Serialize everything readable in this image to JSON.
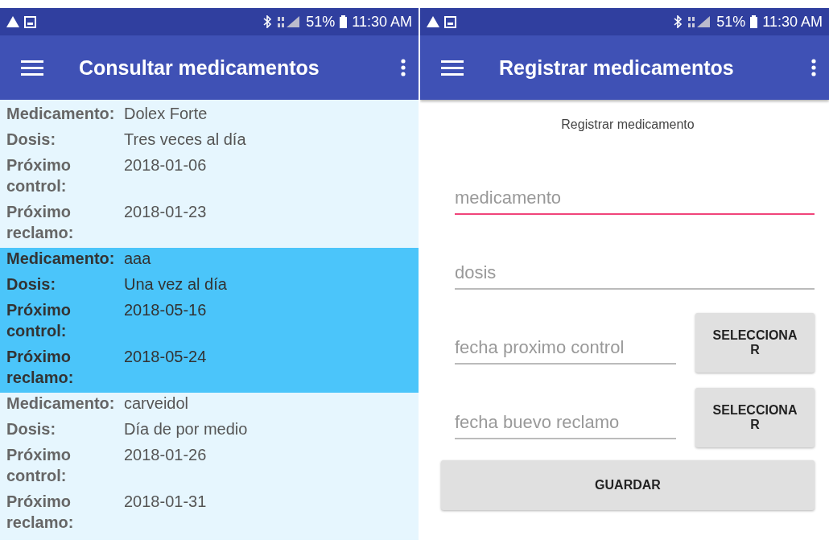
{
  "screens": [
    {
      "status_bar": {
        "battery": "51%",
        "time": "11:30 AM"
      },
      "app_bar": {
        "title": "Consultar medicamentos"
      },
      "records": [
        {
          "selected": false,
          "fields": [
            {
              "label": "Medicamento:",
              "value": "Dolex Forte"
            },
            {
              "label": "Dosis:",
              "value": "Tres veces al día"
            },
            {
              "label": "Próximo control:",
              "value": "2018-01-06"
            },
            {
              "label": "Próximo reclamo:",
              "value": "2018-01-23"
            }
          ]
        },
        {
          "selected": true,
          "fields": [
            {
              "label": "Medicamento:",
              "value": "aaa"
            },
            {
              "label": "Dosis:",
              "value": "Una vez al día"
            },
            {
              "label": "Próximo control:",
              "value": "2018-05-16"
            },
            {
              "label": "Próximo reclamo:",
              "value": "2018-05-24"
            }
          ]
        },
        {
          "selected": false,
          "fields": [
            {
              "label": "Medicamento:",
              "value": "carveidol"
            },
            {
              "label": "Dosis:",
              "value": "Día de por medio"
            },
            {
              "label": "Próximo control:",
              "value": "2018-01-26"
            },
            {
              "label": "Próximo reclamo:",
              "value": "2018-01-31"
            }
          ]
        }
      ]
    },
    {
      "status_bar": {
        "battery": "51%",
        "time": "11:30 AM"
      },
      "app_bar": {
        "title": "Registrar medicamentos"
      },
      "form": {
        "heading": "Registrar medicamento",
        "inputs": [
          {
            "placeholder": "medicamento",
            "focused": true
          },
          {
            "placeholder": "dosis",
            "focused": false
          },
          {
            "placeholder": "fecha proximo control",
            "focused": false,
            "button": "SELECCIONAR"
          },
          {
            "placeholder": "fecha buevo reclamo",
            "focused": false,
            "button": "SELECCIONAR"
          }
        ],
        "submit": "GUARDAR"
      }
    }
  ]
}
